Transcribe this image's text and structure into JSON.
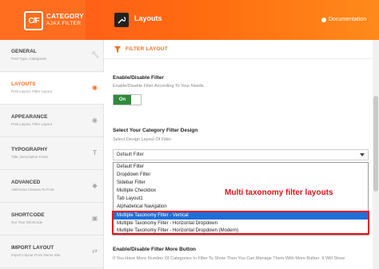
{
  "header": {
    "logo_mark": "C/F",
    "logo_line1": "CATEGORY",
    "logo_line2": "AJAX FILTER",
    "page_title": "Layouts",
    "doc_link": "Documentation",
    "brand_color": "#ff6d1f"
  },
  "sidebar": {
    "items": [
      {
        "title": "GENERAL",
        "sub": "Post Type, Categories",
        "icon": "wrench-icon"
      },
      {
        "title": "LAYOUTS",
        "sub": "Post Layout, Filter Layout",
        "icon": "eye-icon"
      },
      {
        "title": "APPEARANCE",
        "sub": "Post Layout, Filter Layout",
        "icon": "eye-icon"
      },
      {
        "title": "TYPOGRAPHY",
        "sub": "Title, Description Fonts",
        "icon": "text-icon"
      },
      {
        "title": "ADVANCED",
        "sub": "Add Extra Classes To Post",
        "icon": "tag-icon"
      },
      {
        "title": "SHORTCODE",
        "sub": "Get Your Shortcode",
        "icon": "code-icon"
      },
      {
        "title": "IMPORT LAYOUT",
        "sub": "Import Layout From Demo Site",
        "icon": "sync-icon"
      }
    ],
    "active_index": 1
  },
  "main": {
    "section_title": "FILTER LAYOUT",
    "enable_label": "Enable/Disable Filter",
    "enable_desc": "Enable/Disable Filter According To Your Needs.",
    "toggle_label": "On",
    "design_label": "Select Your Category Filter Design",
    "design_desc": "Select Design Layout Of Filter.",
    "select_value": "Default Filter",
    "options": [
      "Default Filter",
      "Dropdown Filter",
      "Sidebar Filter",
      "Multiple Checkbox",
      "Tab Layout1",
      "Alphabetical Navigation",
      "Multiple Taxonomy Filter - Vertical",
      "Multiple Taxonomy Filter - Horizontal Dropdown",
      "Multiple Taxonomy Filter - Horizontal Dropdown (Modern)"
    ],
    "selected_option_index": 6,
    "annotation": "Multi taxonomy filter layouts",
    "more_label": "Enable/Disable Filter More Button",
    "more_desc": "If You Have More Number Of Categories In Filter To Show Then You Can Manage Them With More Button. It Will Show"
  }
}
